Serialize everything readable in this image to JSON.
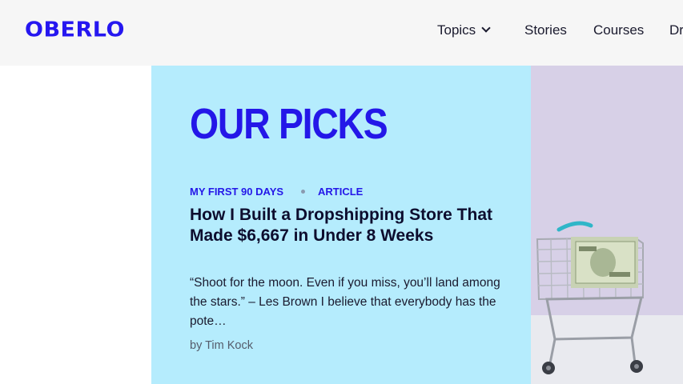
{
  "header": {
    "logo": "OBERLO",
    "nav": {
      "topics": "Topics",
      "stories": "Stories",
      "courses": "Courses",
      "dropshipping_partial": "Dr"
    }
  },
  "feature": {
    "heading": "OUR PICKS",
    "categories": [
      "MY FIRST 90 DAYS",
      "ARTICLE"
    ],
    "title": "How I Built a Dropshipping Store That Made $6,667 in Under 8 Weeks",
    "excerpt": "“Shoot for the moon. Even if you miss, you’ll land among the stars.” – Les Brown  I believe that everybody has the pote…",
    "byline": "by Tim Kock",
    "image_subject": "shopping-cart-with-dollar-bills"
  },
  "colors": {
    "brand_blue": "#2417e8",
    "panel_bg": "#b5ecfd",
    "header_bg": "#f6f6f6"
  }
}
